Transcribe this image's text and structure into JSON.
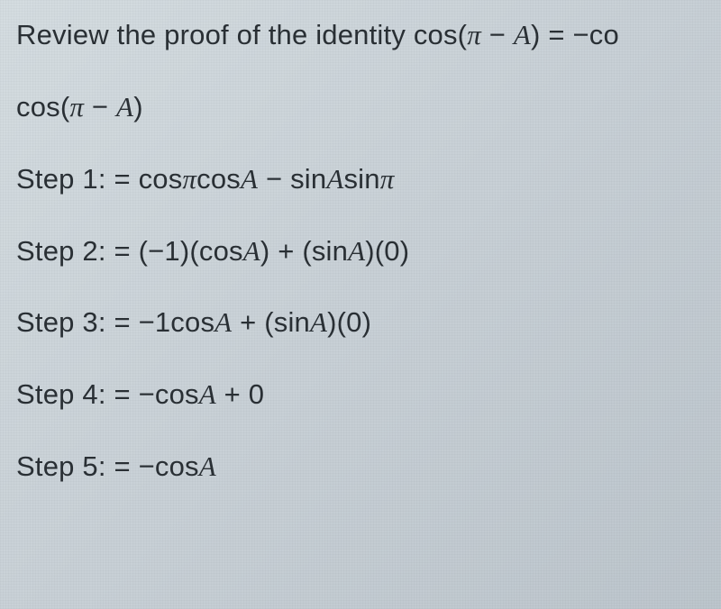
{
  "intro": {
    "prefix": "Review the proof of the identity cos(",
    "pi": "π",
    "mid": " − ",
    "A": "A",
    "suffix": ") = −co"
  },
  "start": {
    "prefix": "cos(",
    "pi": "π",
    "mid": " − ",
    "A": "A",
    "suffix": ")"
  },
  "steps": {
    "s1": {
      "label": "Step 1: = cos",
      "pi1": "π",
      "mid1": "cos",
      "A1": "A",
      "mid2": " − sin",
      "A2": "A",
      "mid3": "sin",
      "pi2": "π"
    },
    "s2": {
      "label": "Step 2: = (−1)(cos",
      "A1": "A",
      "mid1": ") + (sin",
      "A2": "A",
      "suffix": ")(0)"
    },
    "s3": {
      "label": "Step 3: = −1cos",
      "A1": "A",
      "mid1": " + (sin",
      "A2": "A",
      "suffix": ")(0)"
    },
    "s4": {
      "label": "Step 4: = −cos",
      "A1": "A",
      "suffix": " + 0"
    },
    "s5": {
      "label": "Step 5: = −cos",
      "A1": "A"
    }
  }
}
